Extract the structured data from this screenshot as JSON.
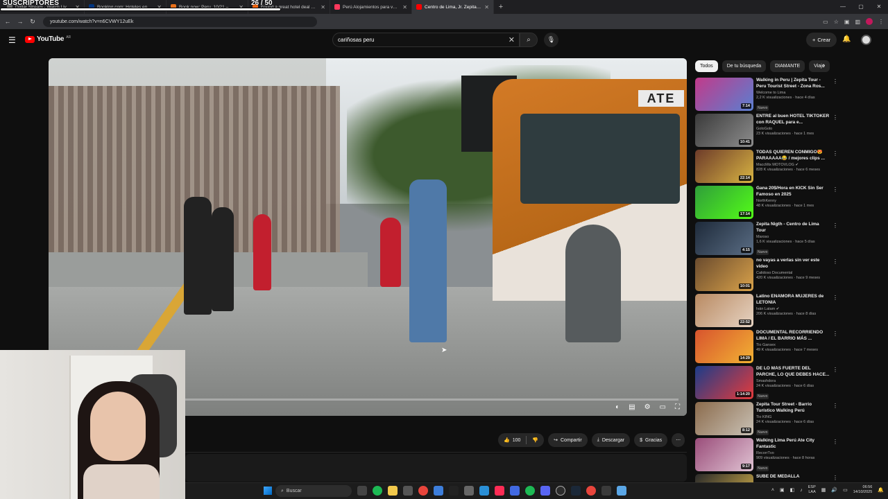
{
  "overlay": {
    "subs_label": "SUSCRIPTORES",
    "count": "26 / 50"
  },
  "tabs": [
    {
      "label": "Dollar Stream · Watch Live on...",
      "color": "#6b6b6b",
      "active": false
    },
    {
      "label": "Booking.com: Hoteles en Lima",
      "color": "#003580",
      "active": false
    },
    {
      "label": "Book now: Peru, 10/21 – 10/22",
      "color": "#e8701a",
      "active": false
    },
    {
      "label": "Found a great hotel deal on KA",
      "color": "#ff690f",
      "active": false
    },
    {
      "label": "Perú Alojamientos para vacacio",
      "color": "#ff385c",
      "active": false
    },
    {
      "label": "Centro de Lima, Jr. Zepita Wall",
      "color": "#ff0000",
      "active": true
    }
  ],
  "browser": {
    "url": "youtube.com/watch?v=n6CVWY12uEk"
  },
  "youtube": {
    "logo_text": "YouTube",
    "country": "AR",
    "search_value": "cariñosas peru",
    "create_label": "Crear"
  },
  "actions": {
    "likes": "100",
    "share": "Compartir",
    "download": "Descargar",
    "thanks": "Gracias"
  },
  "chips": [
    "Todos",
    "De tu búsqueda",
    "DIAMANTE",
    "Viaje"
  ],
  "recommendations": [
    {
      "title": "Walking in Peru | Zepita Tour - Peru Tourist Street - Zona Ros...",
      "channel": "Welcome to Lima",
      "meta": "2,2 K visualizaciones · hace 4 días",
      "badge": "Nuevo",
      "duration": "7:14",
      "c1": "#c23a8a",
      "c2": "#5a7fd0"
    },
    {
      "title": "ENTRÉ al buen HOTEL TIKTOKER con RAQUEL para e...",
      "channel": "GoloGolo",
      "meta": "23 K visualizaciones · hace 1 mes",
      "badge": "",
      "duration": "10:41",
      "c1": "#3a3a3a",
      "c2": "#8d8d8d"
    },
    {
      "title": "TODAS QUIEREN CONMIGO😍 PARAAAAA😂 / mejores clips ...",
      "channel": "MaccMix MOTOVLOG ✔",
      "meta": "828 K visualizaciones · hace 6 meses",
      "badge": "",
      "duration": "22:14",
      "c1": "#6d3b2a",
      "c2": "#d8b442"
    },
    {
      "title": "Gana 20$/Hora en KICK Sin Ser Famoso en 2025",
      "channel": "NorthKenny",
      "meta": "48 K visualizaciones · hace 1 mes",
      "badge": "",
      "duration": "17:14",
      "c1": "#2f9e3a",
      "c2": "#53fc18"
    },
    {
      "title": "Zepita Nigth - Centro de Lima Tour",
      "channel": "Maroso",
      "meta": "1,6 K visualizaciones · hace 5 días",
      "badge": "Nuevo",
      "duration": "4:15",
      "c1": "#1e2a3a",
      "c2": "#5a6d84"
    },
    {
      "title": "no vayas a verlas sin ver este video",
      "channel": "Calidoso Documental",
      "meta": "420 K visualizaciones · hace 9 meses",
      "badge": "",
      "duration": "10:01",
      "c1": "#6a4b2e",
      "c2": "#d9a24a"
    },
    {
      "title": "Latino ENAMORA MUJERES de LETONIA",
      "channel": "Iván Latam ✔",
      "meta": "206 K visualizaciones · hace 8 días",
      "badge": "",
      "duration": "22:52",
      "c1": "#b98a62",
      "c2": "#e6d3c2"
    },
    {
      "title": "DOCUMENTAL RECORRIENDO LIMA / EL BARRIO MÁS ...",
      "channel": "Tio Gansex",
      "meta": "49 K visualizaciones · hace 7 meses",
      "badge": "",
      "duration": "14:29",
      "c1": "#d8542e",
      "c2": "#f2b233"
    },
    {
      "title": "DE LO MÁS FUERTE DEL PARCHE, LO QUE DEBES HACE...",
      "channel": "Smashdora",
      "meta": "24 K visualizaciones · hace 6 días",
      "badge": "Nuevo",
      "duration": "1:14:20",
      "c1": "#1b3c8a",
      "c2": "#e63b3b"
    },
    {
      "title": "Zepita Tour Street - Barrio Turístico Walking Perú",
      "channel": "Tio KING",
      "meta": "24 K visualizaciones · hace 6 días",
      "badge": "Nuevo",
      "duration": "8:12",
      "c1": "#8b6b4c",
      "c2": "#c9c1b5"
    },
    {
      "title": "Walking Lima Perú Ate City Fantastic",
      "channel": "RecorrTvo",
      "meta": "909 visualizaciones · hace 8 horas",
      "badge": "Nuevo",
      "duration": "9:17",
      "c1": "#9a4d7a",
      "c2": "#e0c3d3"
    },
    {
      "title": "SUBE DE MEDALLA",
      "channel": "",
      "meta": "",
      "badge": "",
      "duration": "",
      "c1": "#2a2a2a",
      "c2": "#d9b44a"
    }
  ],
  "taskbar": {
    "search_label": "Buscar",
    "lang_top": "ESP",
    "lang_bottom": "LAA",
    "time": "06:56",
    "date": "14/10/2025"
  }
}
